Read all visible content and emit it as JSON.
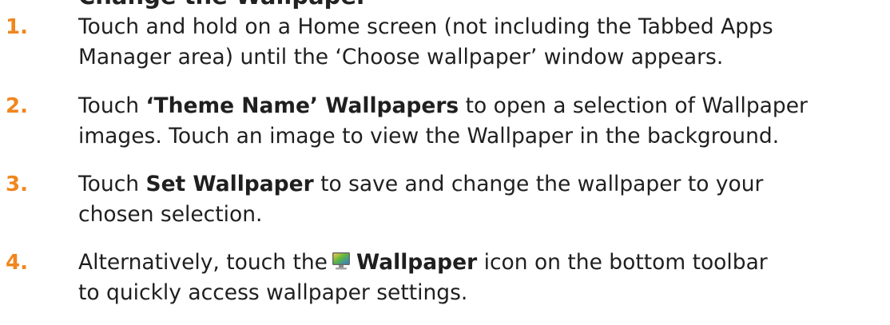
{
  "heading_partial": "Change the Wallpaper",
  "colors": {
    "step_number": "#f0861e",
    "text": "#1f1f1f"
  },
  "steps": [
    {
      "number": "1.",
      "lines": [
        "Touch and hold on a Home screen (not including the Tabbed Apps",
        "Manager area) until the ‘Choose wallpaper’ window appears."
      ]
    },
    {
      "number": "2.",
      "line1_before": "Touch ",
      "line1_bold": "‘Theme Name’ Wallpapers",
      "line1_after": " to open a selection of Wallpaper",
      "line2": "images. Touch an image to view the Wallpaper in the background."
    },
    {
      "number": "3.",
      "line1_before": "Touch ",
      "line1_bold": "Set Wallpaper",
      "line1_after": " to save and change the wallpaper to your",
      "line2": "chosen selection."
    },
    {
      "number": "4.",
      "line1_before": "Alternatively, touch the",
      "icon": "wallpaper-icon",
      "line1_bold": "Wallpaper",
      "line1_after": " icon on the bottom toolbar",
      "line2": "to quickly access wallpaper settings."
    }
  ]
}
